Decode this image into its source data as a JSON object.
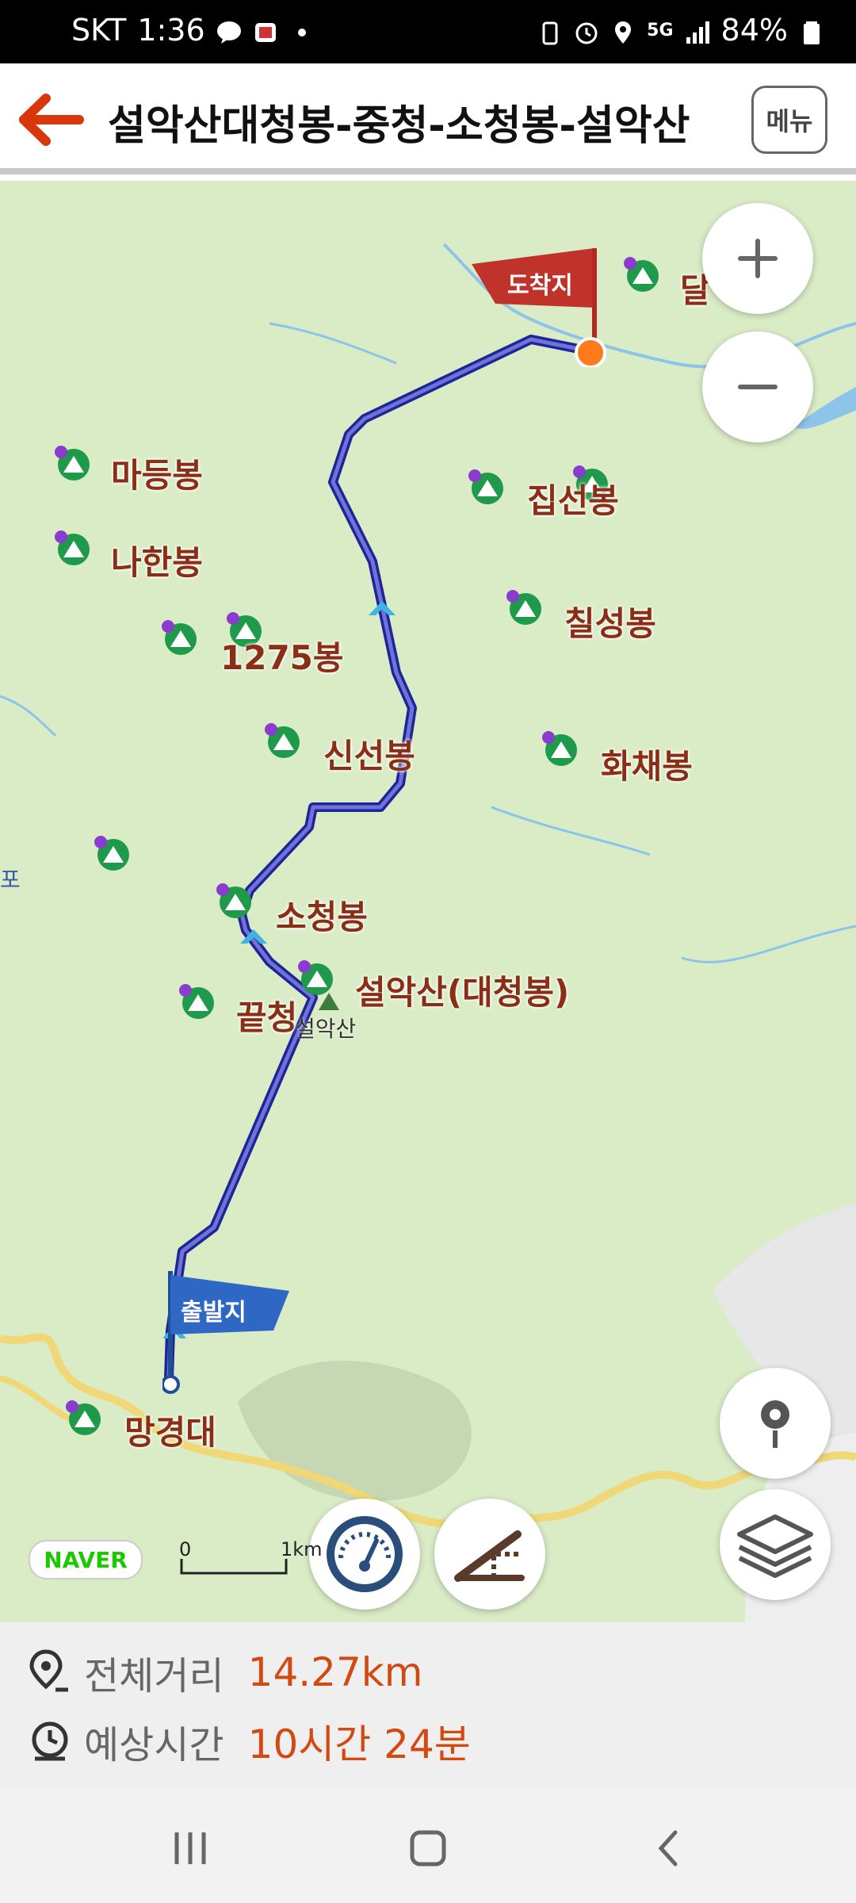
{
  "status": {
    "carrier": "SKT",
    "time": "1:36",
    "battery": "84%",
    "net": "5G"
  },
  "header": {
    "title": "설악산대청봉-중청-소청봉-설악산",
    "menu_label": "메뉴"
  },
  "map": {
    "flags": {
      "end": "도착지",
      "start": "출발지"
    },
    "peaks": [
      "달",
      "마등봉",
      "집선봉",
      "나한봉",
      "칠성봉",
      "1275봉",
      "신선봉",
      "화채봉",
      "소청봉",
      "설악산(대청봉)",
      "끝청",
      "망경대"
    ],
    "place_labels": {
      "seorak": "설악산",
      "edge": "포"
    },
    "provider": "NAVER",
    "scale": {
      "zero": "0",
      "unit": "1km"
    }
  },
  "info": {
    "distance_label": "전체거리",
    "distance_value": "14.27km",
    "time_label": "예상시간",
    "time_value": "10시간 24분"
  },
  "colors": {
    "accent": "#d24a12",
    "route": "#2b2fa8",
    "map_bg": "#d9ecc6"
  }
}
